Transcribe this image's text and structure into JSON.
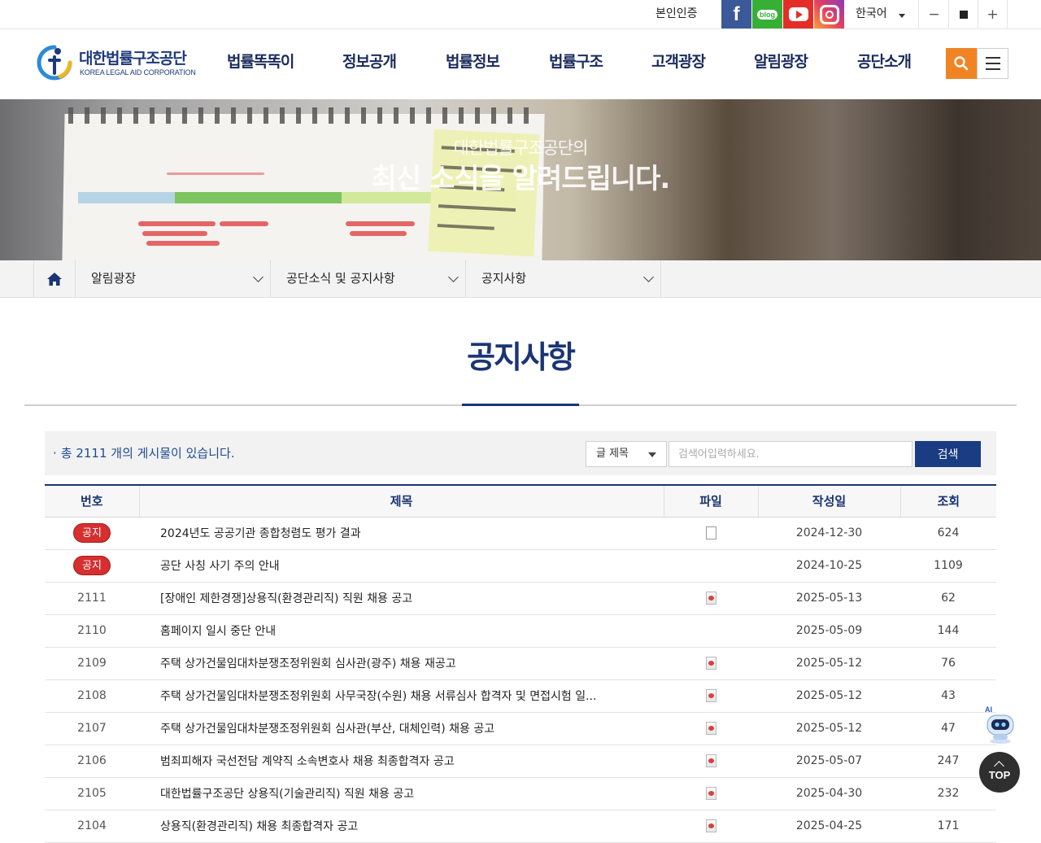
{
  "topbar": {
    "auth_label": "본인인증",
    "sns": [
      {
        "name": "facebook",
        "glyph": "f",
        "color": "#3b5998"
      },
      {
        "name": "blog",
        "glyph": "blog",
        "color": "#35b035"
      },
      {
        "name": "youtube",
        "color": "#e52d27"
      },
      {
        "name": "instagram",
        "color": "#e4405f"
      }
    ],
    "language": "한국어",
    "font_controls": {
      "decrease": "−",
      "increase": "+"
    }
  },
  "header": {
    "logo_ko": "대한법률구조공단",
    "logo_en": "KOREA LEGAL AID CORPORATION",
    "nav": [
      "법률똑똑이",
      "정보공개",
      "법률정보",
      "법률구조",
      "고객광장",
      "알림광장",
      "공단소개"
    ],
    "accent_color": "#f08424"
  },
  "visual": {
    "line1": "대한법률구조공단의",
    "line2": "최신 소식을 알려드립니다."
  },
  "location": {
    "crumbs": [
      "알림광장",
      "공단소식 및 공지사항",
      "공지사항"
    ]
  },
  "page": {
    "title": "공지사항",
    "primary_color": "#1a3573"
  },
  "board": {
    "total_text": "총 2111 개의 게시물이 있습니다.",
    "search_field": "글 제목",
    "search_placeholder": "검색어입력하세요.",
    "search_button": "검색",
    "columns": [
      "번호",
      "제목",
      "파일",
      "작성일",
      "조회"
    ],
    "rows": [
      {
        "no": "공지",
        "notice": true,
        "title": "2024년도 공공기관 종합청렴도 평가 결과",
        "file": "blank",
        "date": "2024-12-30",
        "views": "624"
      },
      {
        "no": "공지",
        "notice": true,
        "title": "공단 사칭 사기 주의 안내",
        "file": "",
        "date": "2024-10-25",
        "views": "1109"
      },
      {
        "no": "2111",
        "notice": false,
        "title": "[장애인 제한경쟁]상용직(환경관리직) 직원 채용 공고",
        "file": "hwp",
        "date": "2025-05-13",
        "views": "62"
      },
      {
        "no": "2110",
        "notice": false,
        "title": "홈페이지 일시 중단 안내",
        "file": "",
        "date": "2025-05-09",
        "views": "144"
      },
      {
        "no": "2109",
        "notice": false,
        "title": "주택 상가건물임대차분쟁조정위원회 심사관(광주) 채용 재공고",
        "file": "hwp",
        "date": "2025-05-12",
        "views": "76"
      },
      {
        "no": "2108",
        "notice": false,
        "title": "주택 상가건물임대차분쟁조정위원회 사무국장(수원) 채용 서류심사 합격자 및 면접시험 일...",
        "file": "hwp",
        "date": "2025-05-12",
        "views": "43"
      },
      {
        "no": "2107",
        "notice": false,
        "title": "주택 상가건물임대차분쟁조정위원회 심사관(부산, 대체인력) 채용 공고",
        "file": "hwp",
        "date": "2025-05-12",
        "views": "47"
      },
      {
        "no": "2106",
        "notice": false,
        "title": "범죄피해자 국선전담 계약직 소속변호사 채용 최종합격자 공고",
        "file": "hwp",
        "date": "2025-05-07",
        "views": "247"
      },
      {
        "no": "2105",
        "notice": false,
        "title": "대한법률구조공단 상용직(기술관리직) 직원 채용 공고",
        "file": "hwp",
        "date": "2025-04-30",
        "views": "232"
      },
      {
        "no": "2104",
        "notice": false,
        "title": "상용직(환경관리직) 채용 최종합격자 공고",
        "file": "hwp",
        "date": "2025-04-25",
        "views": "171"
      }
    ]
  },
  "floating": {
    "ai_label": "AI",
    "top_label": "TOP"
  }
}
